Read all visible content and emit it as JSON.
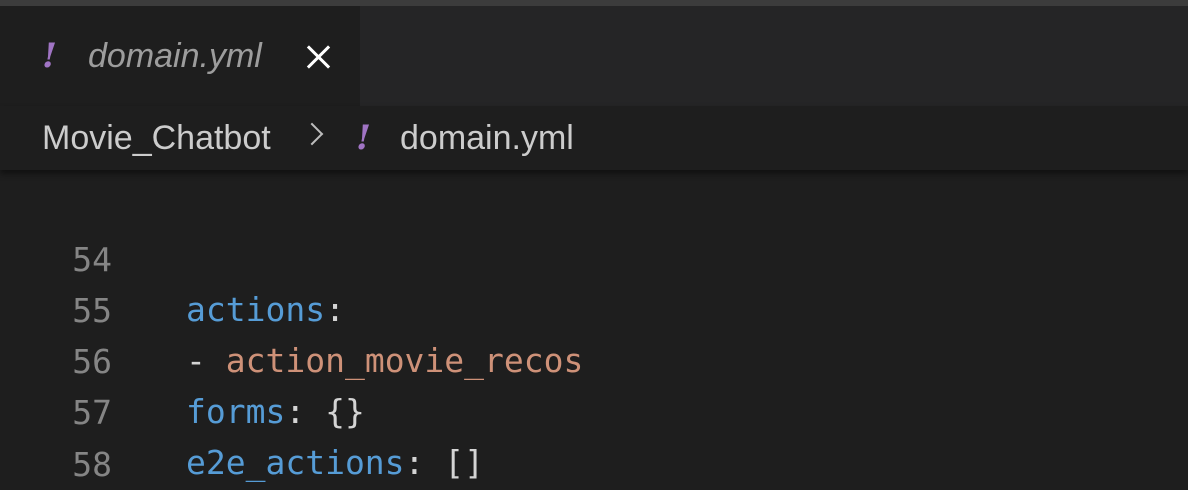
{
  "tab": {
    "icon_glyph": "!",
    "icon_name": "yaml-file-icon",
    "label": "domain.yml",
    "close_icon": "close-icon"
  },
  "breadcrumb": {
    "folder": "Movie_Chatbot",
    "separator_icon": "chevron-right-icon",
    "file_icon_glyph": "!",
    "file": "domain.yml"
  },
  "colors": {
    "background": "#1e1e1e",
    "tab_bar": "#252526",
    "yaml_icon": "#a074c4",
    "key": "#569cd6",
    "string": "#ce9178",
    "punctuation": "#d4d4d4",
    "line_number": "#858585"
  },
  "editor": {
    "lines": [
      {
        "number": "54",
        "key": "actions",
        "punct": ":",
        "rest": ""
      },
      {
        "number": "55",
        "dash": "- ",
        "string": "action_movie_recos"
      },
      {
        "number": "56",
        "key": "forms",
        "punct": ": ",
        "rest": "{}"
      },
      {
        "number": "57",
        "key": "e2e_actions",
        "punct": ": ",
        "rest": "[]"
      },
      {
        "number": "58"
      }
    ]
  }
}
